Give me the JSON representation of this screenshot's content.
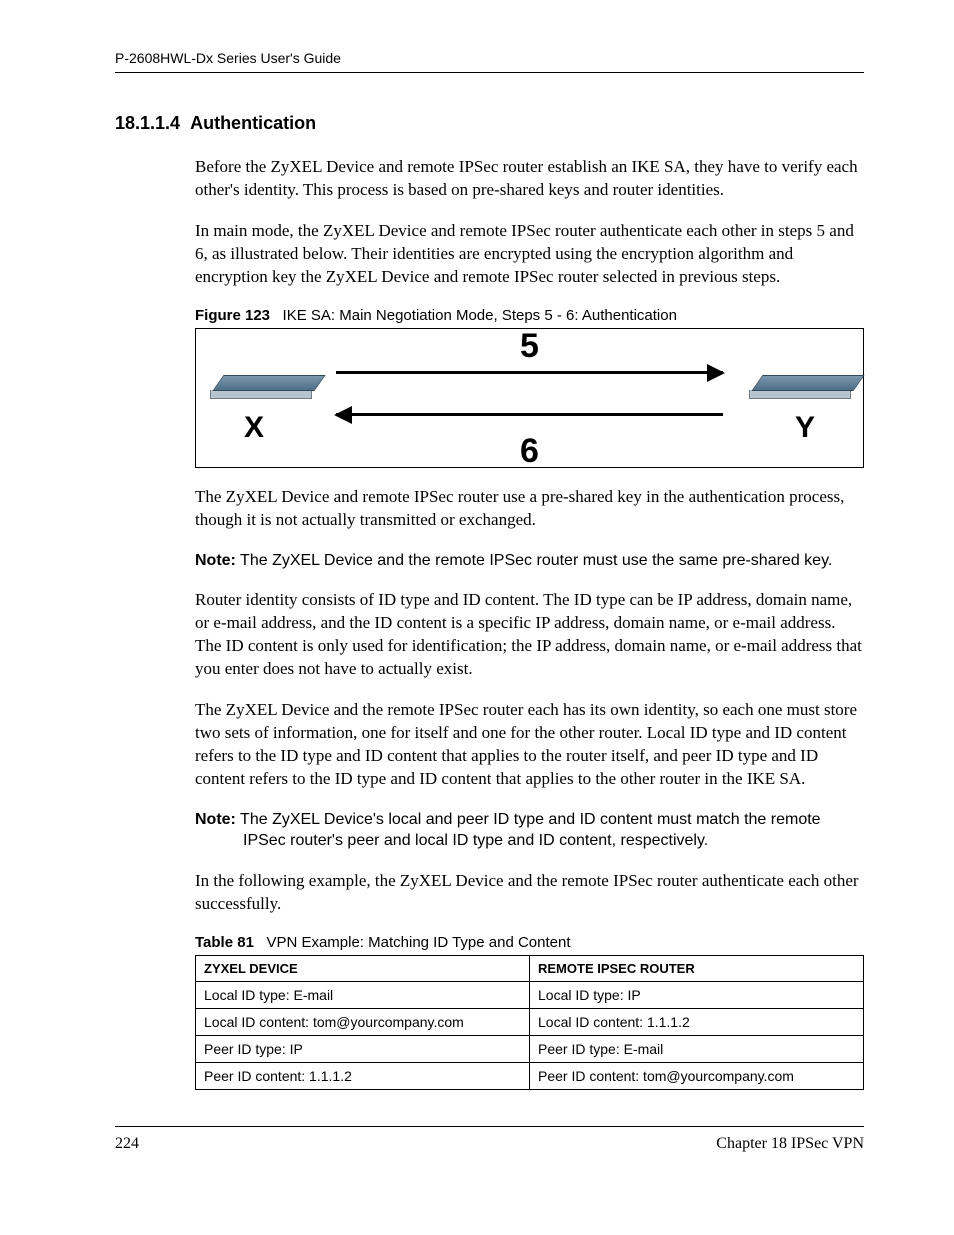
{
  "header": {
    "guide_title": "P-2608HWL-Dx Series User's Guide"
  },
  "section": {
    "number": "18.1.1.4",
    "title": "Authentication"
  },
  "paras": {
    "p1": "Before the ZyXEL Device and remote IPSec router establish an IKE SA, they have to verify each other's identity. This process is based on pre-shared keys and router identities.",
    "p2": "In main mode, the ZyXEL Device and remote IPSec router authenticate each other in steps 5 and 6, as illustrated below. Their identities are encrypted using the encryption algorithm and encryption key the ZyXEL Device and remote IPSec router selected in previous steps.",
    "p3": "The ZyXEL Device and remote IPSec router use a pre-shared key in the authentication process, though it is not actually transmitted or exchanged.",
    "p4": "Router identity consists of ID type and ID content. The ID type can be IP address, domain name, or e-mail address, and the ID content is a specific IP address, domain name, or e-mail address. The ID content is only used for identification; the IP address, domain name, or e-mail address that you enter does not have to actually exist.",
    "p5": "The ZyXEL Device and the remote IPSec router each has its own identity, so each one must store two sets of information, one for itself and one for the other router. Local ID type and ID content refers to the ID type and ID content that applies to the router itself, and peer ID type and ID content refers to the ID type and ID content that applies to the other router in the IKE SA.",
    "p6": "In the following example, the ZyXEL Device and the remote IPSec router authenticate each other successfully."
  },
  "figure": {
    "label": "Figure 123",
    "caption": "IKE SA: Main Negotiation Mode, Steps 5 - 6: Authentication",
    "left_label": "X",
    "right_label": "Y",
    "top_step": "5",
    "bottom_step": "6"
  },
  "notes": {
    "label": "Note:",
    "n1": "The ZyXEL Device and the remote IPSec router must use the same pre-shared key.",
    "n2": "The ZyXEL Device's local and peer ID type and ID content must match the remote IPSec router's peer and local ID type and ID content, respectively."
  },
  "table": {
    "label": "Table 81",
    "caption": "VPN Example: Matching ID Type and Content",
    "head": {
      "c1": "ZYXEL DEVICE",
      "c2": "REMOTE IPSEC ROUTER"
    },
    "rows": [
      {
        "c1": "Local ID type: E-mail",
        "c2": "Local ID type: IP"
      },
      {
        "c1": "Local ID content: tom@yourcompany.com",
        "c2": "Local ID content: 1.1.1.2"
      },
      {
        "c1": "Peer ID type: IP",
        "c2": "Peer ID type: E-mail"
      },
      {
        "c1": "Peer ID content: 1.1.1.2",
        "c2": "Peer ID content: tom@yourcompany.com"
      }
    ]
  },
  "footer": {
    "page": "224",
    "chapter": "Chapter 18 IPSec VPN"
  }
}
